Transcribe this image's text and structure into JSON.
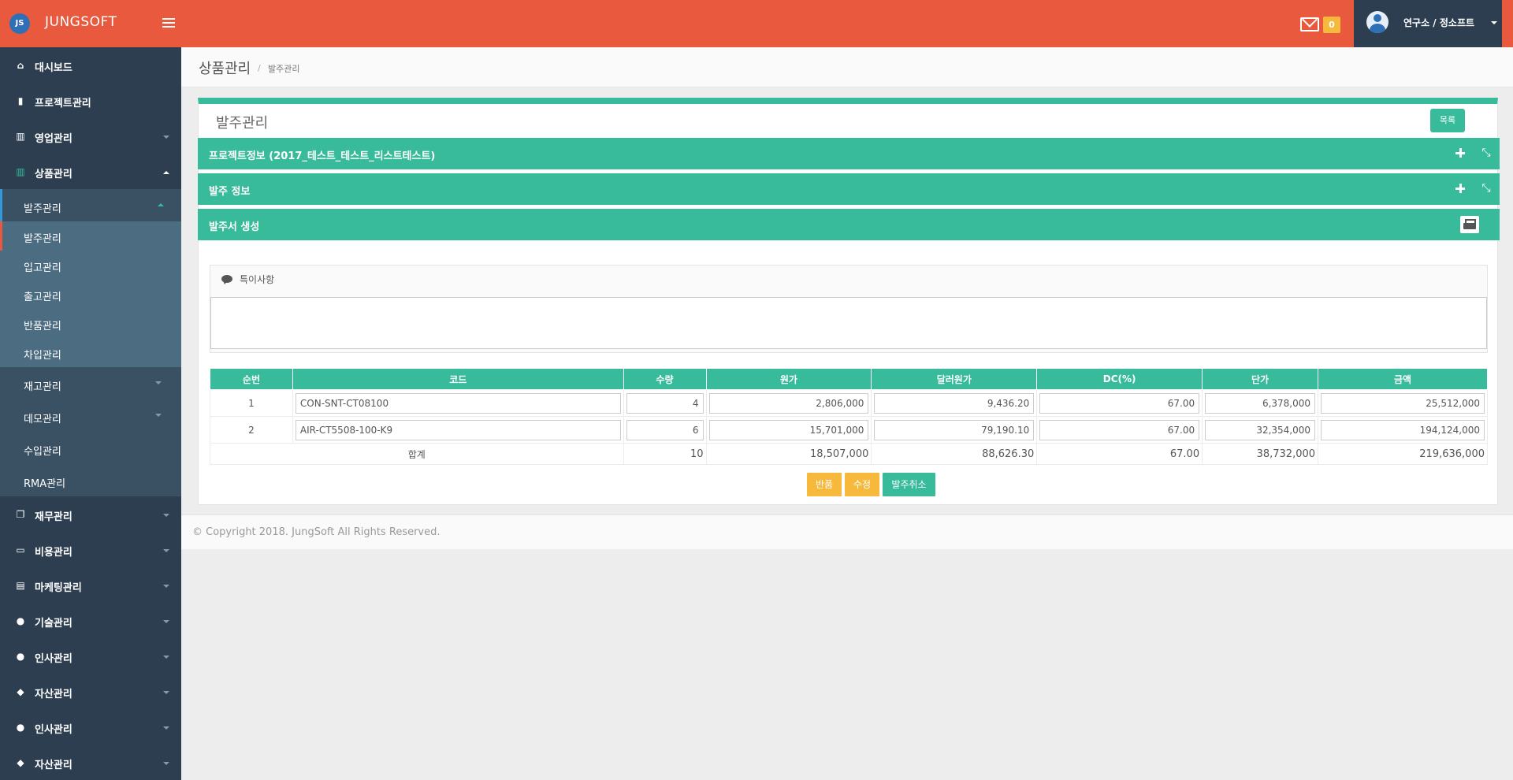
{
  "brand": {
    "logo_text": "JS",
    "name": "JUNGSOFT"
  },
  "header": {
    "mail_count": "0",
    "user_name": "연구소 / 정소프트"
  },
  "sidebar": {
    "items": [
      {
        "label": "대시보드",
        "icon": "home-icon"
      },
      {
        "label": "프로젝트관리",
        "icon": "book-icon"
      },
      {
        "label": "영업관리",
        "icon": "bar-chart-icon"
      },
      {
        "label": "상품관리",
        "icon": "barcode-icon"
      }
    ],
    "product_sub": [
      {
        "label": "발주관리"
      },
      {
        "label": "재고관리"
      },
      {
        "label": "데모관리"
      },
      {
        "label": "수입관리"
      },
      {
        "label": "RMA관리"
      }
    ],
    "order_sub": [
      {
        "label": "발주관리"
      },
      {
        "label": "입고관리"
      },
      {
        "label": "출고관리"
      },
      {
        "label": "반품관리"
      },
      {
        "label": "차입관리"
      }
    ],
    "bottom_items": [
      {
        "label": "재무관리",
        "icon": "copy-icon"
      },
      {
        "label": "비용관리",
        "icon": "credit-card-icon"
      },
      {
        "label": "마케팅관리",
        "icon": "newspaper-icon"
      },
      {
        "label": "기술관리",
        "icon": "user-icon"
      },
      {
        "label": "인사관리",
        "icon": "user-icon"
      },
      {
        "label": "자산관리",
        "icon": "tags-icon"
      },
      {
        "label": "인사관리",
        "icon": "user-icon"
      },
      {
        "label": "자산관리",
        "icon": "tags-icon"
      }
    ]
  },
  "page": {
    "title": "상품관리",
    "breadcrumb": "발주관리"
  },
  "panel": {
    "title": "발주관리",
    "list_button": "목록",
    "sections": {
      "project": "프로젝트정보 (2017_테스트_테스트_리스트테스트)",
      "order": "발주 정보",
      "create": "발주서 생성"
    },
    "remarks_label": "특이사항",
    "remarks_value": ""
  },
  "table": {
    "headers": [
      "순번",
      "코드",
      "수량",
      "원가",
      "달러원가",
      "DC(%)",
      "단가",
      "금액"
    ],
    "rows": [
      {
        "no": "1",
        "code": "CON-SNT-CT08100",
        "qty": "4",
        "cost": "2,806,000",
        "usd_cost": "9,436.20",
        "dc": "67.00",
        "unit": "6,378,000",
        "amount": "25,512,000"
      },
      {
        "no": "2",
        "code": "AIR-CT5508-100-K9",
        "qty": "6",
        "cost": "15,701,000",
        "usd_cost": "79,190.10",
        "dc": "67.00",
        "unit": "32,354,000",
        "amount": "194,124,000"
      }
    ],
    "total": {
      "label": "합계",
      "qty": "10",
      "cost": "18,507,000",
      "usd_cost": "88,626.30",
      "dc": "67.00",
      "unit": "38,732,000",
      "amount": "219,636,000"
    }
  },
  "actions": {
    "return": "반품",
    "edit": "수정",
    "cancel_order": "발주취소"
  },
  "footer": {
    "copyright": "© Copyright 2018. JungSoft All Rights Reserved."
  },
  "colors": {
    "topbar": "#e8593e",
    "sidebar": "#2d3e50",
    "accent": "#37bb9b",
    "warning": "#f6b93b"
  }
}
